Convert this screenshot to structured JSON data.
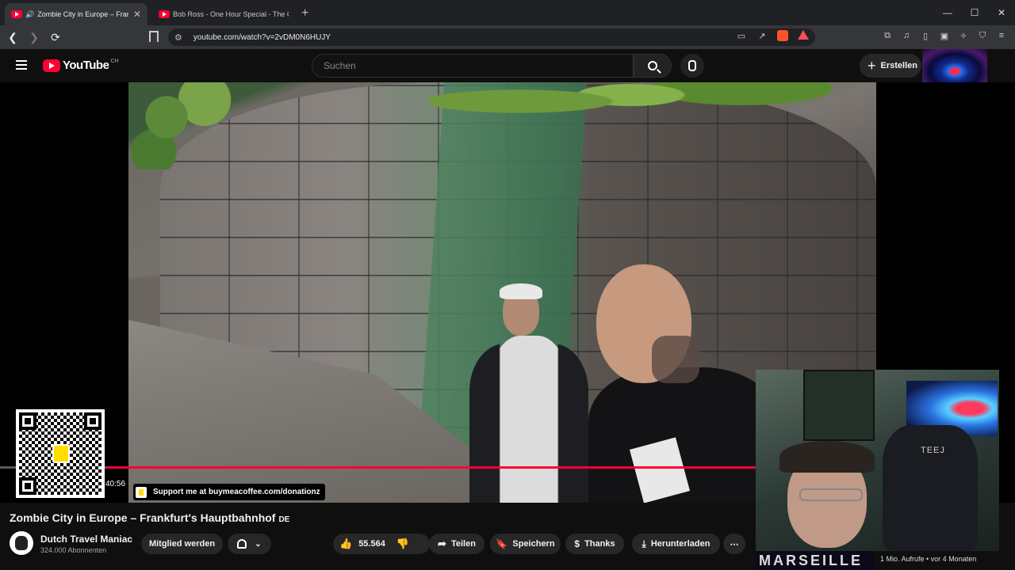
{
  "browser": {
    "tabs": [
      {
        "title": "Zombie City in Europe – Frankfurt's",
        "active": true,
        "audio": true
      },
      {
        "title": "Bob Ross - One Hour Special - The G",
        "active": false,
        "audio": false
      }
    ],
    "url": "youtube.com/watch?v=2vDM0N6HUJY"
  },
  "youtube": {
    "logo_text": "YouTube",
    "country_code": "CH",
    "search_placeholder": "Suchen",
    "create_label": "Erstellen"
  },
  "player": {
    "elapsed": "40:56",
    "progress_fraction": 0.74,
    "support_text": "Support me at buymeacoffee.com/donationz"
  },
  "webcam": {
    "chair_brand": "TEEJ",
    "banner_text": "MARSEILLE"
  },
  "video": {
    "title": "Zombie City in Europe – Frankfurt's Hauptbahnhof",
    "language_badge": "DE",
    "channel_name": "Dutch Travel Maniac",
    "subscribers": "324.000 Abonnenten",
    "subscribed_label": "Mitglied werden",
    "likes": "55.564",
    "share_label": "Teilen",
    "save_label": "Speichern",
    "thanks_label": "Thanks",
    "download_label": "Herunterladen",
    "meta": "1 Mio. Aufrufe • vor 4 Monaten"
  },
  "colors": {
    "accent": "#ff0033",
    "background": "#0f0f0f",
    "pill": "#272727"
  }
}
